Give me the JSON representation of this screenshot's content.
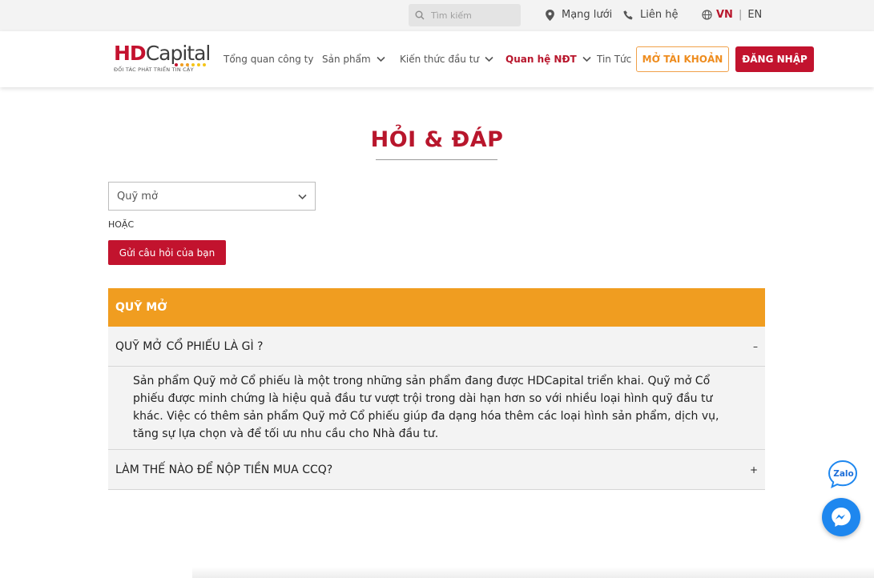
{
  "topbar": {
    "search_placeholder": "Tìm kiếm",
    "network_label": "Mạng lưới",
    "contact_label": "Liên hệ",
    "lang_vn": "VN",
    "lang_separator": "|",
    "lang_en": "EN"
  },
  "logo": {
    "part_hd": "HD",
    "part_capital": "Capital",
    "tagline": "ĐỐI TÁC PHÁT TRIỂN TIN CẬY",
    "dot_colors": [
      "#c4122f",
      "#f09d20",
      "#f09d20",
      "#f5c518",
      "#f5c518",
      "#f5c518"
    ]
  },
  "nav": {
    "items": [
      {
        "label": "Tổng quan công ty",
        "has_dropdown": false,
        "active": false
      },
      {
        "label": "Sản phẩm",
        "has_dropdown": true,
        "active": false
      },
      {
        "label": "Kiến thức đầu tư",
        "has_dropdown": true,
        "active": false
      },
      {
        "label": "Quan hệ NĐT",
        "has_dropdown": true,
        "active": true
      },
      {
        "label": "Tin Tức",
        "has_dropdown": false,
        "active": false
      }
    ],
    "open_account_label": "MỞ TÀI KHOẢN",
    "login_label": "ĐĂNG NHẬP"
  },
  "page": {
    "title": "HỎI & ĐÁP",
    "category_select_value": "Quỹ mở",
    "or_label": "HOẶC",
    "ask_button_label": "Gửi câu hỏi của bạn"
  },
  "faq": {
    "section_title": "QUỸ MỞ",
    "items": [
      {
        "question": "QUỸ MỞ CỔ PHIẾU LÀ GÌ ?",
        "toggle": "–",
        "expanded": true,
        "answer": "Sản phẩm Quỹ mở Cổ phiếu là một trong những sản phẩm đang được HDCapital triển khai. Quỹ mở Cổ phiếu được minh chứng là hiệu quả đầu tư vượt trội trong dài hạn hơn so với nhiều loại hình quỹ đầu tư khác. Việc có thêm sản phẩm Quỹ mở Cổ phiếu giúp đa dạng hóa thêm các loại hình sản phẩm, dịch vụ, tăng sự lựa chọn và để tối ưu nhu cầu cho Nhà đầu tư."
      },
      {
        "question": "LÀM THẾ NÀO ĐỂ NỘP TIỀN MUA CCQ?",
        "toggle": "+",
        "expanded": false
      }
    ]
  },
  "widgets": {
    "zalo_label": "Zalo",
    "colors": {
      "brand_red": "#c2132e",
      "accent_orange": "#f09d20",
      "messenger_blue": "#1e87ef",
      "zalo_blue": "#1e87ef"
    },
    "icons": [
      "search-icon",
      "location-pin-icon",
      "phone-icon",
      "globe-icon",
      "chevron-down-icon",
      "zalo-icon",
      "messenger-icon"
    ]
  }
}
